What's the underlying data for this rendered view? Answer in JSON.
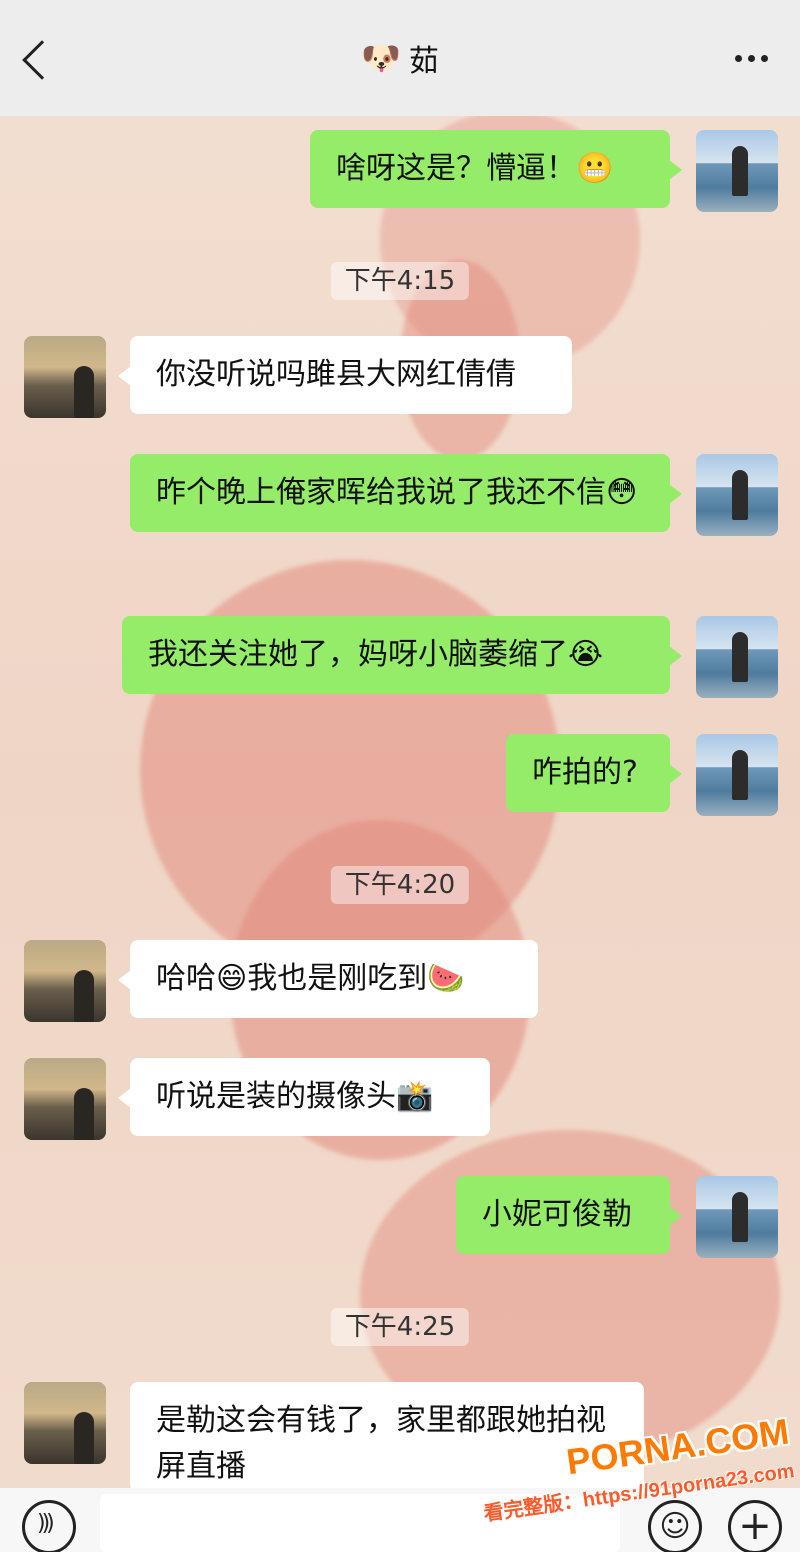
{
  "header": {
    "title_icon": "🐶",
    "title": "茹"
  },
  "messages": [
    {
      "type": "out",
      "text": "啥呀这是？懵逼！😬"
    },
    {
      "type": "time",
      "text": "下午4:15"
    },
    {
      "type": "in",
      "text": "你没听说吗雎县大网红倩倩"
    },
    {
      "type": "out",
      "text": "昨个晚上俺家晖给我说了我还不信😳"
    },
    {
      "type": "out",
      "text": "我还关注她了，妈呀小脑萎缩了😭"
    },
    {
      "type": "out",
      "text": "咋拍的?"
    },
    {
      "type": "time",
      "text": "下午4:20"
    },
    {
      "type": "in",
      "text": "哈哈😄我也是刚吃到🍉"
    },
    {
      "type": "in",
      "text": "听说是装的摄像头📸"
    },
    {
      "type": "out",
      "text": "小妮可俊勒"
    },
    {
      "type": "time",
      "text": "下午4:25"
    },
    {
      "type": "in",
      "text": "是勒这会有钱了，家里都跟她拍视屏直播"
    }
  ],
  "input_bar": {
    "plus_label": "+",
    "emoji_label": "☺"
  },
  "watermark": {
    "logo": "PORNA.COM",
    "url": "看完整版：https://91porna23.com"
  },
  "colors": {
    "outgoing_bubble": "#95ec69",
    "incoming_bubble": "#ffffff",
    "header": "#ededed"
  }
}
